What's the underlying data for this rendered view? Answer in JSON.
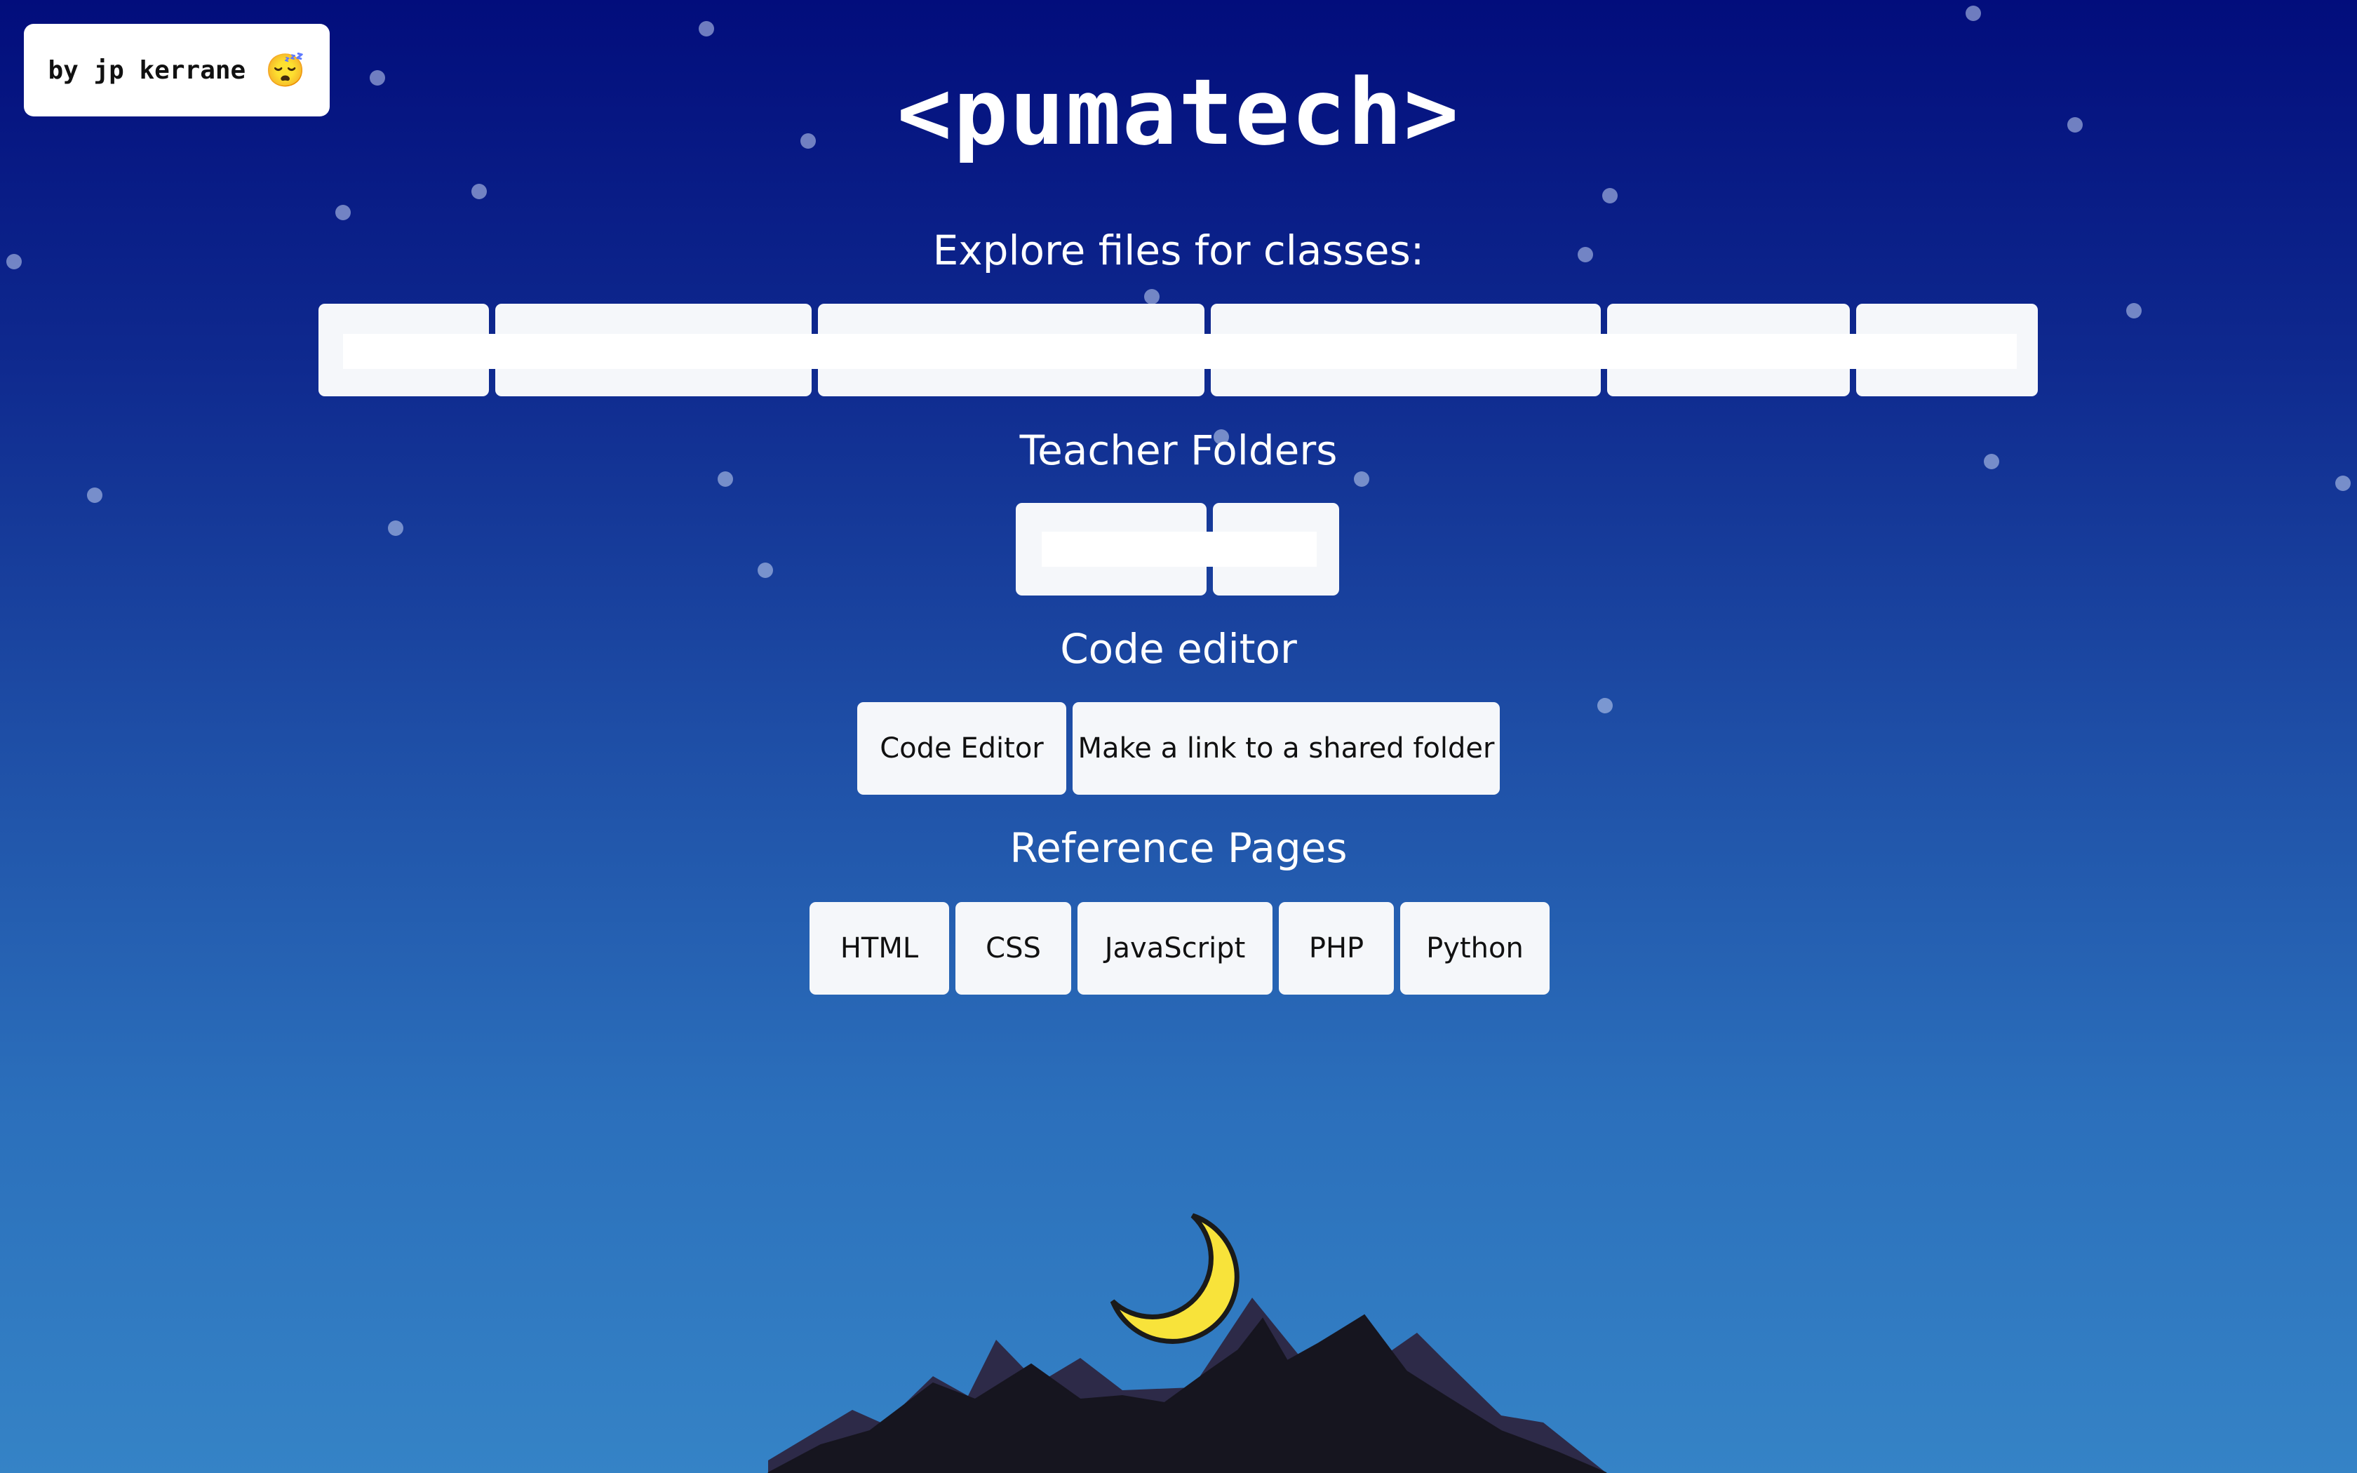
{
  "author_badge": {
    "label": "by jp kerrane",
    "emoji": "😴"
  },
  "site_title": "<pumatech>",
  "sections": {
    "classes": {
      "heading": "Explore files for classes:"
    },
    "teacher_folders": {
      "heading": "Teacher Folders"
    },
    "code_editor": {
      "heading": "Code editor",
      "buttons": [
        "Code Editor",
        "Make a link to a shared folder"
      ]
    },
    "reference": {
      "heading": "Reference Pages",
      "buttons": [
        "HTML",
        "CSS",
        "JavaScript",
        "PHP",
        "Python"
      ]
    }
  },
  "colors": {
    "sky_top": "#020d7c",
    "sky_bottom": "#3583c6",
    "button_bg": "#f5f7fa",
    "moon": "#f8e33a",
    "mountain_front": "#16151f",
    "mountain_back": "#2d2a48"
  },
  "icons": [
    "sleeping-face-emoji",
    "moon-icon",
    "mountains-illustration"
  ]
}
